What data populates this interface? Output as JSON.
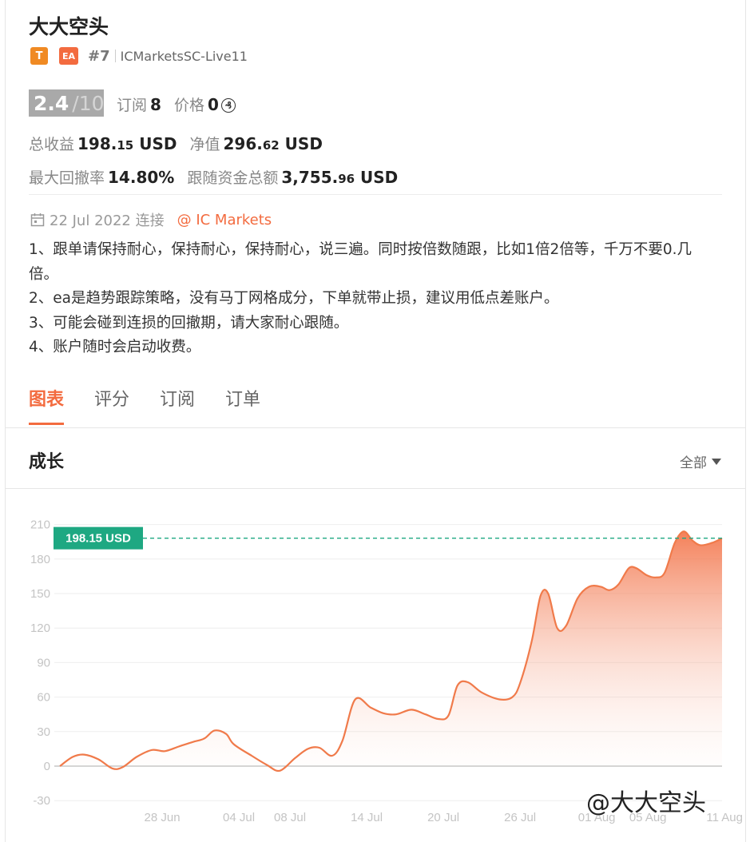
{
  "profile": {
    "name": "大大空头",
    "tag_t": "T",
    "tag_ea": "EA",
    "rank": "#7",
    "server": "ICMarketsSC-Live11"
  },
  "stats": {
    "score": "2.4",
    "score_max": "/10",
    "subscribe_label": "订阅",
    "subscribe_count": "8",
    "price_label": "价格",
    "price_value": "0",
    "price_icon": "coin-icon",
    "total_profit_label": "总收益",
    "total_profit_int": "198.",
    "total_profit_dec": "15",
    "total_profit_unit": " USD",
    "equity_label": "净值",
    "equity_int": "296.",
    "equity_dec": "62",
    "equity_unit": " USD",
    "max_drawdown_label": "最大回撤率",
    "max_drawdown_value": "14.80%",
    "follow_funds_label": "跟随资金总额",
    "follow_funds_int": "3,755.",
    "follow_funds_dec": "96",
    "follow_funds_unit": " USD"
  },
  "connection": {
    "date": "22 Jul 2022 连接",
    "broker": "@ IC Markets"
  },
  "description": [
    "1、跟单请保持耐心，保持耐心，保持耐心，说三遍。同时按倍数随跟，比如1倍2倍等，千万不要0.几倍。",
    "2、ea是趋势跟踪策略，没有马丁网格成分，下单就带止损，建议用低点差账户。",
    "3、可能会碰到连损的回撤期，请大家耐心跟随。",
    "4、账户随时会启动收费。"
  ],
  "tabs": [
    {
      "label": "图表",
      "active": true
    },
    {
      "label": "评分",
      "active": false
    },
    {
      "label": "订阅",
      "active": false
    },
    {
      "label": "订单",
      "active": false
    }
  ],
  "section": {
    "title": "成长",
    "range_label": "全部"
  },
  "watermark": "@大大空头",
  "chart_data": {
    "type": "area",
    "title": "",
    "xlabel": "",
    "ylabel": "",
    "ylim": [
      -30,
      210
    ],
    "yticks": [
      -30,
      0,
      30,
      60,
      90,
      120,
      150,
      180,
      210
    ],
    "x_start": "2022-06-20",
    "x_ticks": [
      {
        "date": "2022-06-28",
        "label": "28 Jun"
      },
      {
        "date": "2022-07-04",
        "label": "04 Jul"
      },
      {
        "date": "2022-07-08",
        "label": "08 Jul"
      },
      {
        "date": "2022-07-14",
        "label": "14 Jul"
      },
      {
        "date": "2022-07-20",
        "label": "20 Jul"
      },
      {
        "date": "2022-07-26",
        "label": "26 Jul"
      },
      {
        "date": "2022-08-01",
        "label": "01 Aug"
      },
      {
        "date": "2022-08-05",
        "label": "05 Aug"
      },
      {
        "date": "2022-08-11",
        "label": "11 Aug"
      }
    ],
    "current_value": 198.15,
    "current_label": "198.15 USD",
    "line_color": "#f07a4a",
    "marker_color": "#1ea882",
    "grid": true,
    "points": [
      [
        0,
        0
      ],
      [
        1.0,
        8
      ],
      [
        1.9,
        10
      ],
      [
        3.0,
        6
      ],
      [
        4.1,
        -2
      ],
      [
        4.9,
        -1
      ],
      [
        6.0,
        8
      ],
      [
        7.2,
        14
      ],
      [
        8.2,
        13
      ],
      [
        9.3,
        17
      ],
      [
        10.4,
        21
      ],
      [
        11.3,
        24
      ],
      [
        12.1,
        31
      ],
      [
        13.0,
        28
      ],
      [
        13.6,
        19
      ],
      [
        15.0,
        9
      ],
      [
        16.2,
        1
      ],
      [
        17.2,
        -4
      ],
      [
        18.4,
        7
      ],
      [
        19.4,
        15
      ],
      [
        20.3,
        16
      ],
      [
        21.3,
        9
      ],
      [
        22.1,
        22
      ],
      [
        23.1,
        58
      ],
      [
        24.3,
        51
      ],
      [
        25.3,
        46
      ],
      [
        26.3,
        45
      ],
      [
        27.5,
        49
      ],
      [
        28.6,
        45
      ],
      [
        29.6,
        41
      ],
      [
        30.4,
        44
      ],
      [
        31.1,
        70
      ],
      [
        31.9,
        73
      ],
      [
        33.0,
        64
      ],
      [
        34.4,
        58
      ],
      [
        35.4,
        60
      ],
      [
        36.0,
        72
      ],
      [
        36.9,
        108
      ],
      [
        37.6,
        148
      ],
      [
        38.2,
        150
      ],
      [
        38.9,
        120
      ],
      [
        39.6,
        122
      ],
      [
        40.5,
        146
      ],
      [
        41.4,
        156
      ],
      [
        42.3,
        156
      ],
      [
        43.0,
        153
      ],
      [
        43.7,
        158
      ],
      [
        44.5,
        172
      ],
      [
        45.1,
        172
      ],
      [
        45.9,
        166
      ],
      [
        46.6,
        164
      ],
      [
        47.3,
        168
      ],
      [
        48.1,
        194
      ],
      [
        48.8,
        204
      ],
      [
        49.5,
        196
      ],
      [
        50.1,
        192
      ],
      [
        51.0,
        194
      ],
      [
        51.8,
        198
      ]
    ]
  }
}
